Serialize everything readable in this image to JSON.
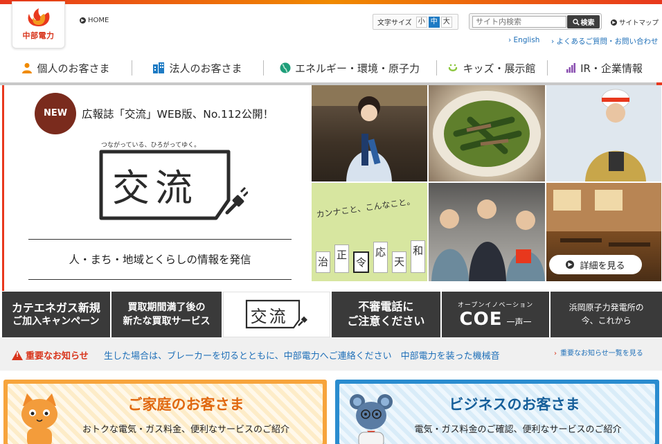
{
  "header": {
    "logo_text": "中部電力",
    "home": "HOME",
    "font_size": {
      "label": "文字サイズ",
      "options": [
        "小",
        "中",
        "大"
      ],
      "selected": "中"
    },
    "search": {
      "placeholder": "サイト内検索",
      "button": "検索"
    },
    "sitemap": "サイトマップ",
    "english": "English",
    "faq": "よくあるご質問・お問い合わせ"
  },
  "nav": {
    "items": [
      {
        "label": "個人のお客さま",
        "icon": "person-icon"
      },
      {
        "label": "法人のお客さま",
        "icon": "building-icon"
      },
      {
        "label": "エネルギー・環境・原子力",
        "icon": "globe-icon"
      },
      {
        "label": "キッズ・展示館",
        "icon": "smile-icon"
      },
      {
        "label": "IR・企業情報",
        "icon": "bar-chart-icon"
      }
    ]
  },
  "hero": {
    "badge": "NEW",
    "headline": "広報誌「交流」WEB版、No.112公開！",
    "tagline": "つながっている、ひろがってゆく。",
    "logo_text": "交流",
    "subtitle": "人・まち・地域とくらしの情報を発信",
    "detail_button": "詳細を見る",
    "tile_texts": {
      "kannako": "カンナこと、こんなこと。",
      "chars": [
        "治",
        "正",
        "令",
        "応",
        "天",
        "和"
      ]
    }
  },
  "banners": [
    {
      "line1": "カテエネガス新規",
      "line2": "ご加入キャンペーン"
    },
    {
      "line1": "買取期間満了後の",
      "line2": "新たな買取サービス"
    },
    {
      "logo": "交流"
    },
    {
      "line1": "不審電話に",
      "line2": "ご注意ください"
    },
    {
      "small": "オープンイノベーション",
      "big": "COE",
      "sub": "一声一"
    },
    {
      "line1": "浜岡原子力発電所の",
      "line2": "今、これから"
    }
  ],
  "notice": {
    "label": "重要なお知らせ",
    "text": "生した場合は、ブレーカーを切るとともに、中部電力へご連絡ください　中部電力を装った機械音",
    "link": "重要なお知らせ一覧を見る"
  },
  "cards": {
    "home": {
      "title": "ご家庭のお客さま",
      "desc": "おトクな電気・ガス料金、便利なサービスのご紹介"
    },
    "biz": {
      "title": "ビジネスのお客さま",
      "desc": "電気・ガス料金のご確認、便利なサービスのご紹介"
    }
  },
  "colors": {
    "brand_red": "#e8381d",
    "brand_orange": "#f08a00",
    "link_blue": "#1e6fb8",
    "notice_red": "#d8341b"
  }
}
